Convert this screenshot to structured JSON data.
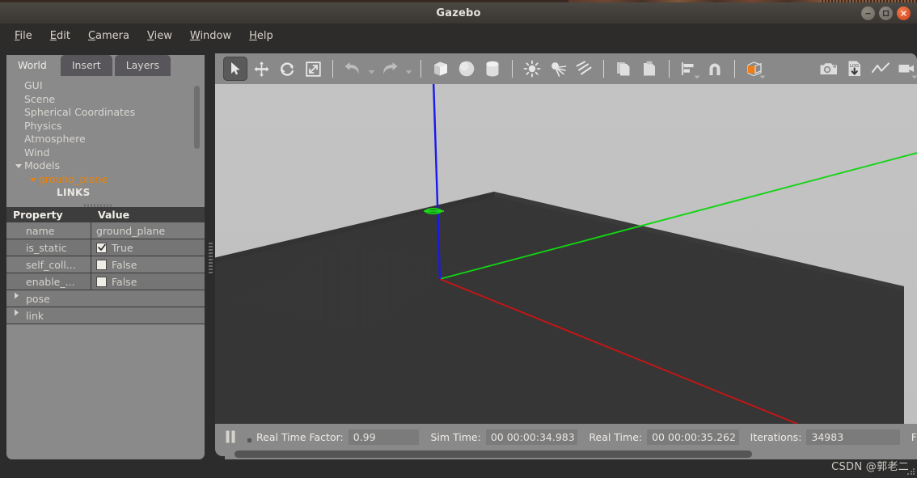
{
  "window": {
    "title": "Gazebo",
    "controls": [
      {
        "name": "minimize",
        "glyph": "minimize-icon"
      },
      {
        "name": "maximize",
        "glyph": "maximize-icon"
      },
      {
        "name": "close",
        "glyph": "close-icon"
      }
    ]
  },
  "menubar": {
    "items": [
      {
        "label": "File",
        "mnemonic": "F"
      },
      {
        "label": "Edit",
        "mnemonic": "E"
      },
      {
        "label": "Camera",
        "mnemonic": "C"
      },
      {
        "label": "View",
        "mnemonic": "V"
      },
      {
        "label": "Window",
        "mnemonic": "W"
      },
      {
        "label": "Help",
        "mnemonic": "H"
      }
    ]
  },
  "panel": {
    "tabs": [
      {
        "label": "World",
        "active": true
      },
      {
        "label": "Insert",
        "active": false
      },
      {
        "label": "Layers",
        "active": false
      }
    ],
    "tree": [
      {
        "label": "GUI",
        "level": 0,
        "caret": "none",
        "style": "normal"
      },
      {
        "label": "Scene",
        "level": 0,
        "caret": "none",
        "style": "normal"
      },
      {
        "label": "Spherical Coordinates",
        "level": 0,
        "caret": "none",
        "style": "normal"
      },
      {
        "label": "Physics",
        "level": 0,
        "caret": "none",
        "style": "normal"
      },
      {
        "label": "Atmosphere",
        "level": 0,
        "caret": "none",
        "style": "normal"
      },
      {
        "label": "Wind",
        "level": 0,
        "caret": "none",
        "style": "normal"
      },
      {
        "label": "Models",
        "level": 0,
        "caret": "down",
        "style": "normal"
      },
      {
        "label": "ground_plane",
        "level": 1,
        "caret": "down",
        "style": "model"
      },
      {
        "label": "LINKS",
        "level": 2,
        "caret": "none",
        "style": "links"
      }
    ],
    "properties": {
      "header": {
        "key": "Property",
        "value": "Value"
      },
      "rows": [
        {
          "key": "name",
          "value": "ground_plane",
          "type": "text"
        },
        {
          "key": "is_static",
          "value": "True",
          "type": "checkbox",
          "checked": true
        },
        {
          "key": "self_coll...",
          "value": "False",
          "type": "checkbox",
          "checked": false
        },
        {
          "key": "enable_...",
          "value": "False",
          "type": "checkbox",
          "checked": false
        },
        {
          "key": "pose",
          "value": "",
          "type": "expander"
        },
        {
          "key": "link",
          "value": "",
          "type": "expander"
        }
      ]
    }
  },
  "toolbar": {
    "buttons": [
      {
        "name": "select-mode-icon",
        "title": "Select mode",
        "active": true
      },
      {
        "name": "translate-mode-icon",
        "title": "Translation mode",
        "active": false
      },
      {
        "name": "rotate-mode-icon",
        "title": "Rotation mode",
        "active": false
      },
      {
        "name": "scale-mode-icon",
        "title": "Scale mode",
        "active": false
      },
      {
        "name": "undo-icon",
        "title": "Undo",
        "active": false
      },
      {
        "name": "undo-dropdown-icon",
        "title": "Undo history",
        "active": false
      },
      {
        "name": "redo-icon",
        "title": "Redo",
        "active": false
      },
      {
        "name": "redo-dropdown-icon",
        "title": "Redo history",
        "active": false
      },
      {
        "name": "box-icon",
        "title": "Box",
        "active": false
      },
      {
        "name": "sphere-icon",
        "title": "Sphere",
        "active": false
      },
      {
        "name": "cylinder-icon",
        "title": "Cylinder",
        "active": false
      },
      {
        "name": "point-light-icon",
        "title": "Point light",
        "active": false
      },
      {
        "name": "spot-light-icon",
        "title": "Spot light",
        "active": false
      },
      {
        "name": "directional-light-icon",
        "title": "Directional light",
        "active": false
      },
      {
        "name": "copy-icon",
        "title": "Copy",
        "active": false
      },
      {
        "name": "paste-icon",
        "title": "Paste",
        "active": false
      },
      {
        "name": "align-icon",
        "title": "Align",
        "active": false
      },
      {
        "name": "snap-icon",
        "title": "Snap",
        "active": false
      },
      {
        "name": "view-angle-icon",
        "title": "Change view angle",
        "active": false
      },
      {
        "name": "screenshot-icon",
        "title": "Take a screenshot",
        "active": false
      },
      {
        "name": "log-record-icon",
        "title": "Record a log",
        "active": false
      },
      {
        "name": "plot-icon",
        "title": "Plotting utility",
        "active": false
      },
      {
        "name": "video-record-icon",
        "title": "Record a video",
        "active": false
      }
    ]
  },
  "viewport": {
    "scene_name": "gazebo-3d-scene",
    "axes": [
      {
        "name": "z-axis",
        "color": "#1818f0"
      },
      {
        "name": "y-axis",
        "color": "#12d412"
      },
      {
        "name": "x-axis",
        "color": "#c81414"
      }
    ],
    "sky_color": "#c1c1c1",
    "ground_color": "#363636"
  },
  "statusbar": {
    "play_pause": "pause-icon",
    "fields": [
      {
        "label": "Real Time Factor:",
        "value": "0.99",
        "width": "w-rtf"
      },
      {
        "label": "Sim Time:",
        "value": "00 00:00:34.983",
        "width": "w-sim"
      },
      {
        "label": "Real Time:",
        "value": "00 00:00:35.262",
        "width": "w-real"
      },
      {
        "label": "Iterations:",
        "value": "34983",
        "width": "w-iter"
      }
    ],
    "truncated_label": "F"
  },
  "watermark": {
    "text": "CSDN @郭老二"
  }
}
